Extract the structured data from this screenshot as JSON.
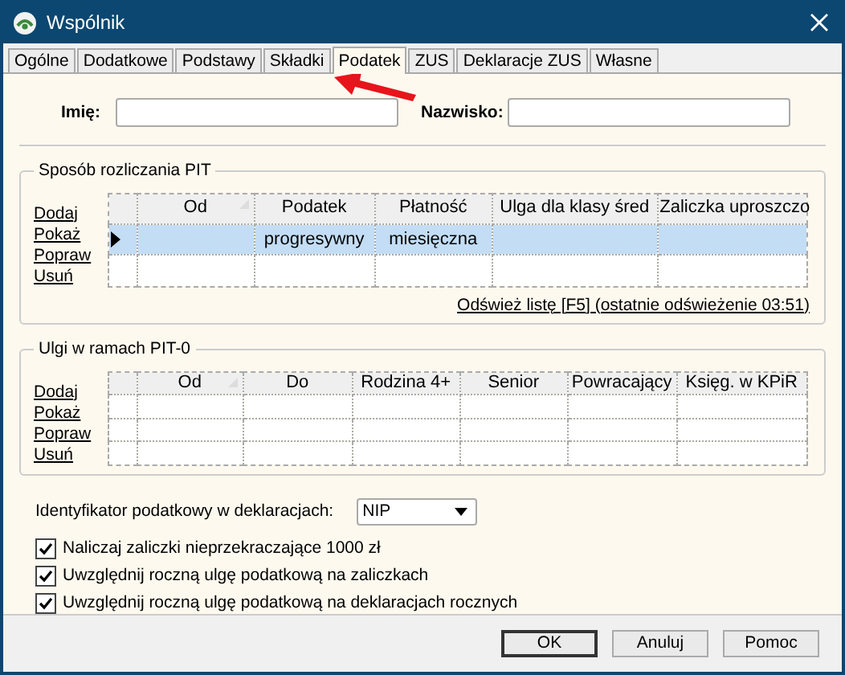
{
  "window": {
    "title": "Wspólnik"
  },
  "tabs": [
    {
      "label": "Ogólne",
      "selected": false
    },
    {
      "label": "Dodatkowe",
      "selected": false
    },
    {
      "label": "Podstawy",
      "selected": false
    },
    {
      "label": "Składki",
      "selected": false
    },
    {
      "label": "Podatek",
      "selected": true
    },
    {
      "label": "ZUS",
      "selected": false
    },
    {
      "label": "Deklaracje ZUS",
      "selected": false
    },
    {
      "label": "Własne",
      "selected": false
    }
  ],
  "name_fields": [
    {
      "label": "Imię:"
    },
    {
      "label": "Nazwisko:"
    }
  ],
  "groups": [
    {
      "title": "Sposób rozliczania PIT",
      "actions": [
        "Dodaj",
        "Pokaż",
        "Popraw",
        "Usuń"
      ],
      "table": {
        "columns": [
          {
            "label": "Od",
            "sorted": true
          },
          {
            "label": "Podatek",
            "sorted": false
          },
          {
            "label": "Płatność",
            "sorted": false
          },
          {
            "label": "Ulga dla klasy śred",
            "sorted": false
          },
          {
            "label": "Zaliczka uproszczo",
            "sorted": false
          }
        ],
        "rows": [
          {
            "selected": true,
            "cells": [
              null,
              "progresywny",
              "miesięczna",
              null,
              null
            ]
          },
          {
            "selected": false
          }
        ]
      },
      "refresh_link": "Odśwież listę [F5] (ostatnie odświeżenie 03:51)"
    },
    {
      "title": "Ulgi w ramach PIT-0",
      "actions": [
        "Dodaj",
        "Pokaż",
        "Popraw",
        "Usuń"
      ],
      "table": {
        "columns": [
          {
            "label": "Od",
            "sorted": true
          },
          {
            "label": "Do",
            "sorted": false
          },
          {
            "label": "Rodzina 4+",
            "sorted": false
          },
          {
            "label": "Senior",
            "sorted": false
          },
          {
            "label": "Powracający",
            "sorted": false
          },
          {
            "label": "Księg. w KPiR",
            "sorted": false
          }
        ],
        "rows": [
          {
            "selected": false
          },
          {
            "selected": false
          },
          {
            "selected": false
          }
        ]
      }
    }
  ],
  "tax_id": {
    "label": "Identyfikator podatkowy w deklaracjach:",
    "value": "NIP"
  },
  "checkboxes": [
    {
      "label": "Naliczaj zaliczki nieprzekraczające 1000 zł",
      "checked": true
    },
    {
      "label": "Uwzględnij roczną ulgę podatkową na zaliczkach",
      "checked": true
    },
    {
      "label": "Uwzględnij roczną ulgę podatkową na deklaracjach rocznych",
      "checked": true
    }
  ],
  "buttons": [
    {
      "label": "OK",
      "default": true
    },
    {
      "label": "Anuluj",
      "default": false
    },
    {
      "label": "Pomoc",
      "default": false
    }
  ]
}
